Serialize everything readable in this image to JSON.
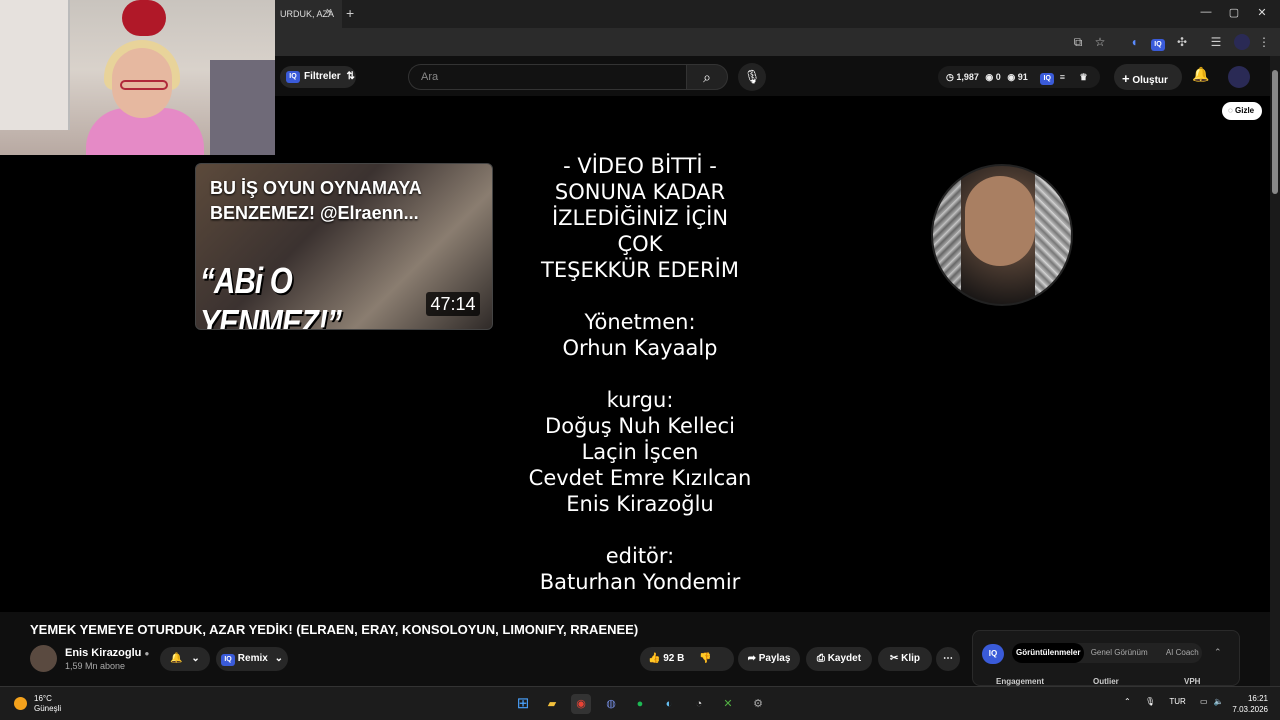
{
  "browser": {
    "tab_title": "URDUK, AZA",
    "new_tab": "+",
    "close_tab": "×",
    "window_controls": [
      "—",
      "▢",
      "✕"
    ]
  },
  "youtube_header": {
    "filter_label": "Filtreler",
    "iq_badge": "IQ",
    "search_placeholder": "Ara",
    "stats": {
      "views": "1,987",
      "zero": "0",
      "ninety_one": "91"
    },
    "create_label": "Oluştur"
  },
  "endcard": {
    "hide_label": "Gizle",
    "video": {
      "title_line1": "BU İŞ OYUN OYNAMAYA",
      "title_line2": "BENZEMEZ! @Elraenn...",
      "thumb_text": "“ABi O YENMEZ!”",
      "duration": "47:14"
    },
    "credits": [
      "- VİDEO BİTTİ -",
      "SONUNA KADAR",
      "İZLEDİĞİNİZ İÇİN",
      "ÇOK",
      "TEŞEKKÜR EDERİM",
      "",
      "Yönetmen:",
      "Orhun Kayaalp",
      "",
      "kurgu:",
      "Doğuş Nuh Kelleci",
      "Laçin İşcen",
      "Cevdet Emre Kızılcan",
      "Enis Kirazoğlu",
      "",
      "editör:",
      "Baturhan Yondemir"
    ]
  },
  "video_info": {
    "title": "YEMEK YEMEYE OTURDUK, AZAR YEDİK! (ELRAEN, ERAY, KONSOLOYUN, LIMONIFY, RRAENEE)",
    "channel_name": "Enis Kirazoglu",
    "subscribers": "1,59 Mn abone",
    "remix_label": "Remix",
    "likes": "92 B",
    "share_label": "Paylaş",
    "save_label": "Kaydet",
    "clip_label": "Klip"
  },
  "analytics_panel": {
    "tabs": [
      "Görüntülenmeler",
      "Genel Görünüm",
      "AI Coach"
    ],
    "headers": [
      "Engagement",
      "Outlier",
      "VPH"
    ]
  },
  "taskbar": {
    "temperature": "16°C",
    "weather": "Güneşli",
    "language": "TUR",
    "time": "16:21",
    "date": "7.03.2026"
  },
  "colors": {
    "iq_blue": "#3a5bd9",
    "bg": "#0f0f0f",
    "pill": "#272727"
  }
}
